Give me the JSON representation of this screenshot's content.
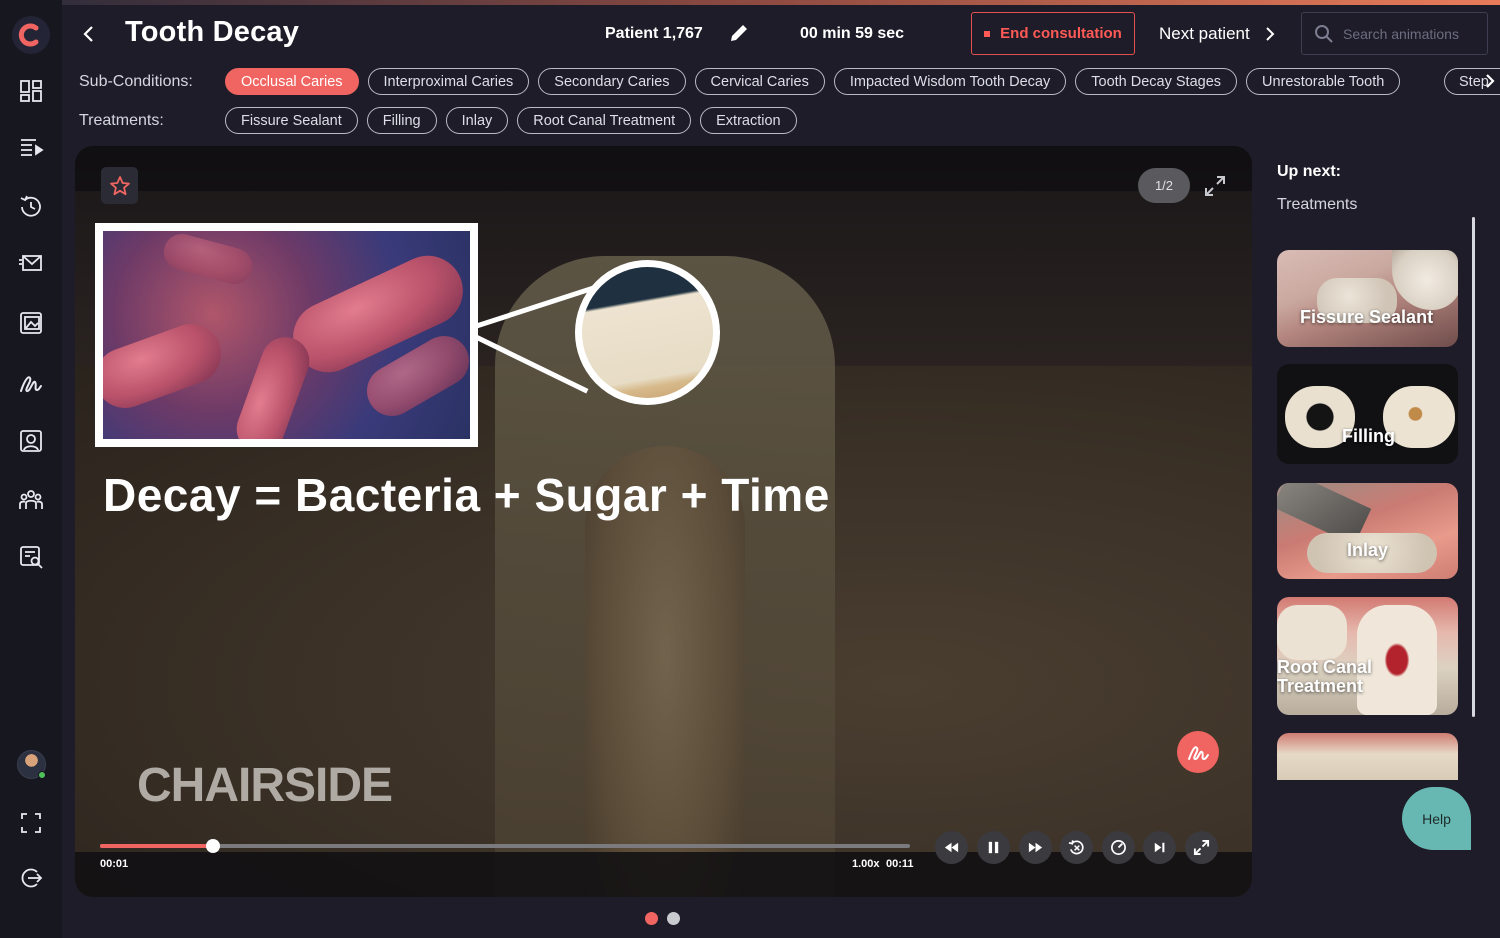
{
  "header": {
    "title": "Tooth Decay",
    "patient": "Patient 1,767",
    "timer": "00 min 59 sec",
    "end_consultation": "End consultation",
    "next_patient": "Next patient",
    "search_placeholder": "Search animations"
  },
  "subconditions": {
    "label": "Sub-Conditions:",
    "items": [
      "Occlusal Caries",
      "Interproximal Caries",
      "Secondary Caries",
      "Cervical Caries",
      "Impacted Wisdom Tooth Decay",
      "Tooth Decay Stages",
      "Unrestorable Tooth"
    ],
    "more": "Step",
    "active_index": 0
  },
  "treatments": {
    "label": "Treatments:",
    "items": [
      "Fissure Sealant",
      "Filling",
      "Inlay",
      "Root Canal Treatment",
      "Extraction"
    ]
  },
  "player": {
    "page_indicator": "1/2",
    "headline": "Decay = Bacteria + Sugar + Time",
    "watermark": "CHAIRSIDE",
    "current_time": "00:01",
    "speed": "1.00x",
    "duration": "00:11",
    "progress_fraction": 0.14
  },
  "slides": {
    "count": 2,
    "active_index": 0
  },
  "upnext": {
    "label": "Up next:",
    "section": "Treatments",
    "items": [
      {
        "label": "Fissure Sealant"
      },
      {
        "label": "Filling"
      },
      {
        "label": "Inlay"
      },
      {
        "label": "Root Canal\nTreatment"
      },
      {
        "label": ""
      }
    ]
  },
  "help": "Help",
  "colors": {
    "accent": "#f06561",
    "end_button": "#e2514f",
    "help": "#67b8b2",
    "background": "#1d1c28"
  }
}
